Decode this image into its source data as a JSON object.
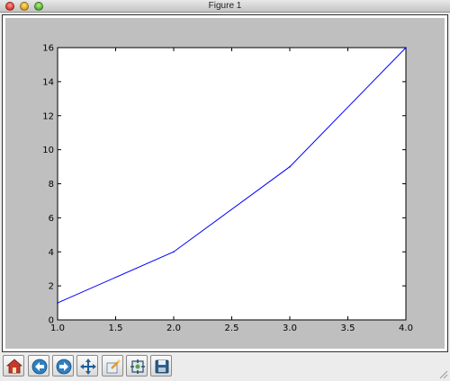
{
  "window": {
    "title": "Figure 1",
    "buttons": [
      "close",
      "minimize",
      "zoom"
    ]
  },
  "toolbar": {
    "icons": [
      "home-icon",
      "back-arrow-icon",
      "forward-arrow-icon",
      "pan-icon",
      "zoom-rect-icon",
      "subplots-icon",
      "save-icon"
    ]
  },
  "colors": {
    "line": "#0000ff",
    "figure_background": "#bfbfbf",
    "axes_background": "#ffffff"
  },
  "chart_data": {
    "type": "line",
    "title": "",
    "xlabel": "",
    "ylabel": "",
    "x": [
      1.0,
      2.0,
      3.0,
      4.0
    ],
    "series": [
      {
        "values": [
          1,
          4,
          9,
          16
        ]
      }
    ],
    "xlim": [
      1.0,
      4.0
    ],
    "ylim": [
      0,
      16
    ],
    "xticks": [
      "1.0",
      "1.5",
      "2.0",
      "2.5",
      "3.0",
      "3.5",
      "4.0"
    ],
    "yticks": [
      "0",
      "2",
      "4",
      "6",
      "8",
      "10",
      "12",
      "14",
      "16"
    ],
    "grid": false,
    "legend": "none"
  }
}
